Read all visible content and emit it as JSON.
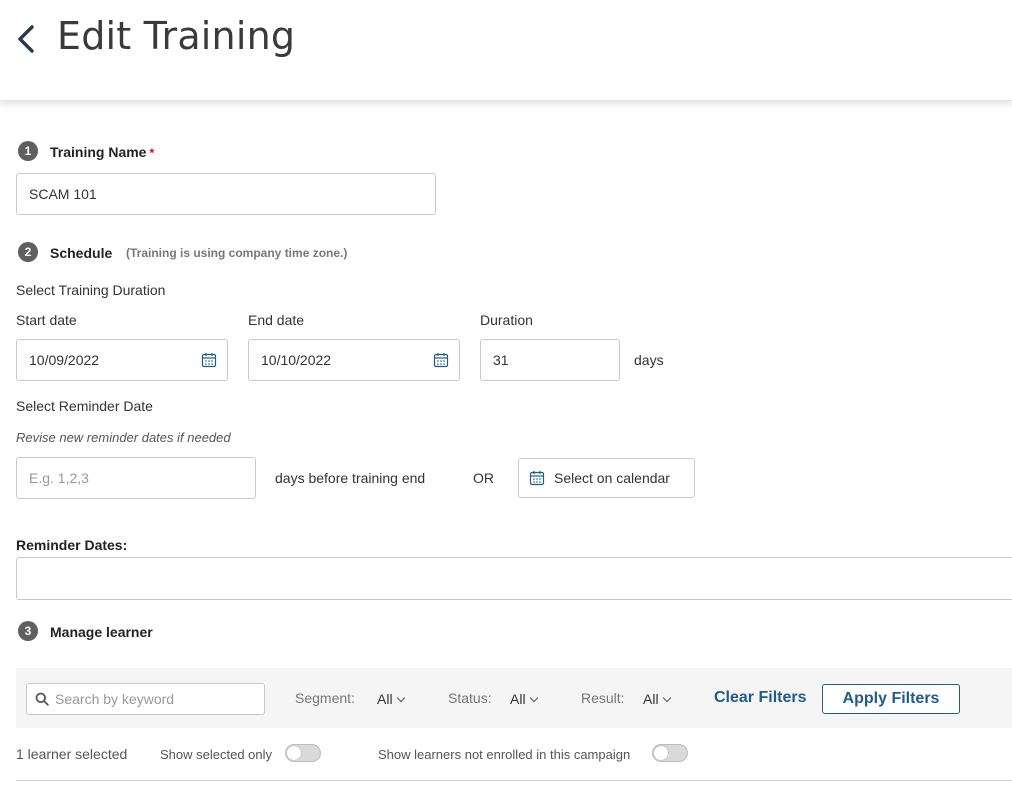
{
  "header": {
    "title": "Edit Training"
  },
  "sections": {
    "training_name": {
      "step": "1",
      "title": "Training Name",
      "required_mark": "*",
      "value": "SCAM 101"
    },
    "schedule": {
      "step": "2",
      "title": "Schedule",
      "hint": "(Training is using company time zone.)",
      "duration_heading": "Select Training Duration",
      "start_label": "Start date",
      "start_value": "10/09/2022",
      "end_label": "End date",
      "end_value": "10/10/2022",
      "duration_label": "Duration",
      "duration_value": "31",
      "duration_unit": "days",
      "reminder_heading": "Select Reminder Date",
      "reminder_hint": "Revise new reminder dates if needed",
      "reminder_placeholder": "E.g. 1,2,3",
      "reminder_suffix": "days before training end",
      "or_text": "OR",
      "calendar_button": "Select on calendar",
      "reminder_dates_label": "Reminder Dates:",
      "reminder_dates_value": ""
    },
    "learners": {
      "step": "3",
      "title": "Manage learner",
      "search_placeholder": "Search by keyword",
      "segment_label": "Segment:",
      "segment_value": "All",
      "status_label": "Status:",
      "status_value": "All",
      "result_label": "Result:",
      "result_value": "All",
      "clear_filters": "Clear Filters",
      "apply_filters": "Apply Filters",
      "selected_count": "1 learner selected",
      "show_selected_only": "Show selected only",
      "show_not_enrolled": "Show learners not enrolled in this campaign"
    }
  },
  "colors": {
    "accent": "#1f5c8a",
    "badge": "#5f5f5f",
    "required": "#d0021b"
  },
  "icons": {
    "back": "chevron-left-icon",
    "calendar": "calendar-icon",
    "search": "search-icon"
  }
}
